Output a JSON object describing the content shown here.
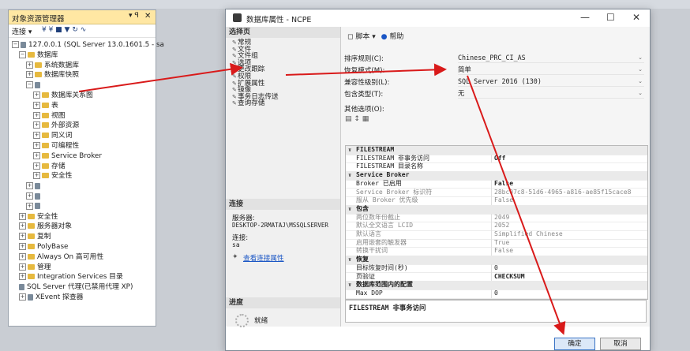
{
  "object_explorer": {
    "title": "对象资源管理器",
    "pin": "▾ ꟼ",
    "close": "✕",
    "toolbar": {
      "connect": "连接 ▾",
      "icons": "¥ ¥ ■ ▼ ↻ ∿"
    },
    "tree": [
      {
        "label": "127.0.0.1 (SQL Server 13.0.1601.5 - sa",
        "indent": 0,
        "exp": "−",
        "icon": "server-icon"
      },
      {
        "label": "数据库",
        "indent": 1,
        "exp": "−",
        "icon": "folder-icon"
      },
      {
        "label": "系统数据库",
        "indent": 2,
        "exp": "+",
        "icon": "folder-icon"
      },
      {
        "label": "数据库快照",
        "indent": 2,
        "exp": "+",
        "icon": "folder-icon"
      },
      {
        "label": "",
        "indent": 2,
        "exp": "−",
        "icon": "database-icon"
      },
      {
        "label": "数据库关系图",
        "indent": 3,
        "exp": "+",
        "icon": "folder-icon"
      },
      {
        "label": "表",
        "indent": 3,
        "exp": "+",
        "icon": "folder-icon"
      },
      {
        "label": "视图",
        "indent": 3,
        "exp": "+",
        "icon": "folder-icon"
      },
      {
        "label": "外部资源",
        "indent": 3,
        "exp": "+",
        "icon": "folder-icon"
      },
      {
        "label": "同义词",
        "indent": 3,
        "exp": "+",
        "icon": "folder-icon"
      },
      {
        "label": "可编程性",
        "indent": 3,
        "exp": "+",
        "icon": "folder-icon"
      },
      {
        "label": "Service Broker",
        "indent": 3,
        "exp": "+",
        "icon": "folder-icon"
      },
      {
        "label": "存储",
        "indent": 3,
        "exp": "+",
        "icon": "folder-icon"
      },
      {
        "label": "安全性",
        "indent": 3,
        "exp": "+",
        "icon": "folder-icon"
      },
      {
        "label": "",
        "indent": 2,
        "exp": "+",
        "icon": "database-icon"
      },
      {
        "label": "",
        "indent": 2,
        "exp": "+",
        "icon": "database-icon"
      },
      {
        "label": "",
        "indent": 2,
        "exp": "+",
        "icon": "database-icon"
      },
      {
        "label": "安全性",
        "indent": 1,
        "exp": "+",
        "icon": "folder-icon"
      },
      {
        "label": "服务器对象",
        "indent": 1,
        "exp": "+",
        "icon": "folder-icon"
      },
      {
        "label": "复制",
        "indent": 1,
        "exp": "+",
        "icon": "folder-icon"
      },
      {
        "label": "PolyBase",
        "indent": 1,
        "exp": "+",
        "icon": "folder-icon"
      },
      {
        "label": "Always On 高可用性",
        "indent": 1,
        "exp": "+",
        "icon": "folder-icon"
      },
      {
        "label": "管理",
        "indent": 1,
        "exp": "+",
        "icon": "folder-icon"
      },
      {
        "label": "Integration Services 目录",
        "indent": 1,
        "exp": "+",
        "icon": "folder-icon"
      },
      {
        "label": "SQL Server 代理(已禁用代理 XP)",
        "indent": 1,
        "exp": "",
        "icon": "agent-icon"
      },
      {
        "label": "XEvent 探查器",
        "indent": 1,
        "exp": "+",
        "icon": "xevent-icon"
      }
    ]
  },
  "dialog": {
    "title": "数据库属性 - NCPE",
    "window_controls": {
      "minimize": "—",
      "maximize": "☐",
      "close": "✕"
    },
    "select_page_header": "选择页",
    "pages": [
      "常规",
      "文件",
      "文件组",
      "选项",
      "更改跟踪",
      "权限",
      "扩展属性",
      "镜像",
      "事务日志传送",
      "查询存储"
    ],
    "connection_header": "连接",
    "server_label": "服务器:",
    "server_value": "DESKTOP-2RMATAJ\\MSSQLSERVER",
    "connection_label": "连接:",
    "connection_value": "sa",
    "view_conn_link": "查看连接属性",
    "progress_header": "进度",
    "progress_status": "就绪",
    "toolbar": {
      "script": "脚本 ▾",
      "help": "帮助"
    },
    "form": [
      {
        "label": "排序规则(C):",
        "value": "Chinese_PRC_CI_AS"
      },
      {
        "label": "恢复模式(M):",
        "value": "简单"
      },
      {
        "label": "兼容性级别(L):",
        "value": "SQL Server 2016 (130)"
      },
      {
        "label": "包含类型(T):",
        "value": "无"
      }
    ],
    "other_options_label": "其他选项(O):",
    "grid": [
      {
        "cat": true,
        "name": "FILESTREAM"
      },
      {
        "name": "FILESTREAM 非事务访问",
        "value": "Off",
        "bold": true
      },
      {
        "name": "FILESTREAM 目录名称",
        "value": ""
      },
      {
        "cat": true,
        "name": "Service Broker"
      },
      {
        "name": "Broker 已启用",
        "value": "False",
        "bold": true
      },
      {
        "name": "Service Broker 标识符",
        "value": "28bc07c8-51d6-4965-a816-ae85f15cace8",
        "dim": true
      },
      {
        "name": "服从 Broker 优先级",
        "value": "False",
        "dim": true
      },
      {
        "cat": true,
        "name": "包含"
      },
      {
        "name": "两位数年份截止",
        "value": "2049",
        "dim": true
      },
      {
        "name": "默认全文语言 LCID",
        "value": "2052",
        "dim": true
      },
      {
        "name": "默认语言",
        "value": "Simplified Chinese",
        "dim": true
      },
      {
        "name": "启用嵌套的触发器",
        "value": "True",
        "dim": true
      },
      {
        "name": "转换干扰词",
        "value": "False",
        "dim": true
      },
      {
        "cat": true,
        "name": "恢复"
      },
      {
        "name": "目标恢复时间(秒)",
        "value": "0"
      },
      {
        "name": "页验证",
        "value": "CHECKSUM",
        "bold": true
      },
      {
        "cat": true,
        "name": "数据库范围内的配置"
      },
      {
        "name": "Max DOP",
        "value": "0"
      }
    ],
    "description": "FILESTREAM 非事务访问",
    "ok_button": "确定",
    "cancel_button": "取消"
  },
  "colors": {
    "arrow": "#d91a1a",
    "oe_title_bg": "#ffe7a3",
    "link": "#1a56c5"
  }
}
